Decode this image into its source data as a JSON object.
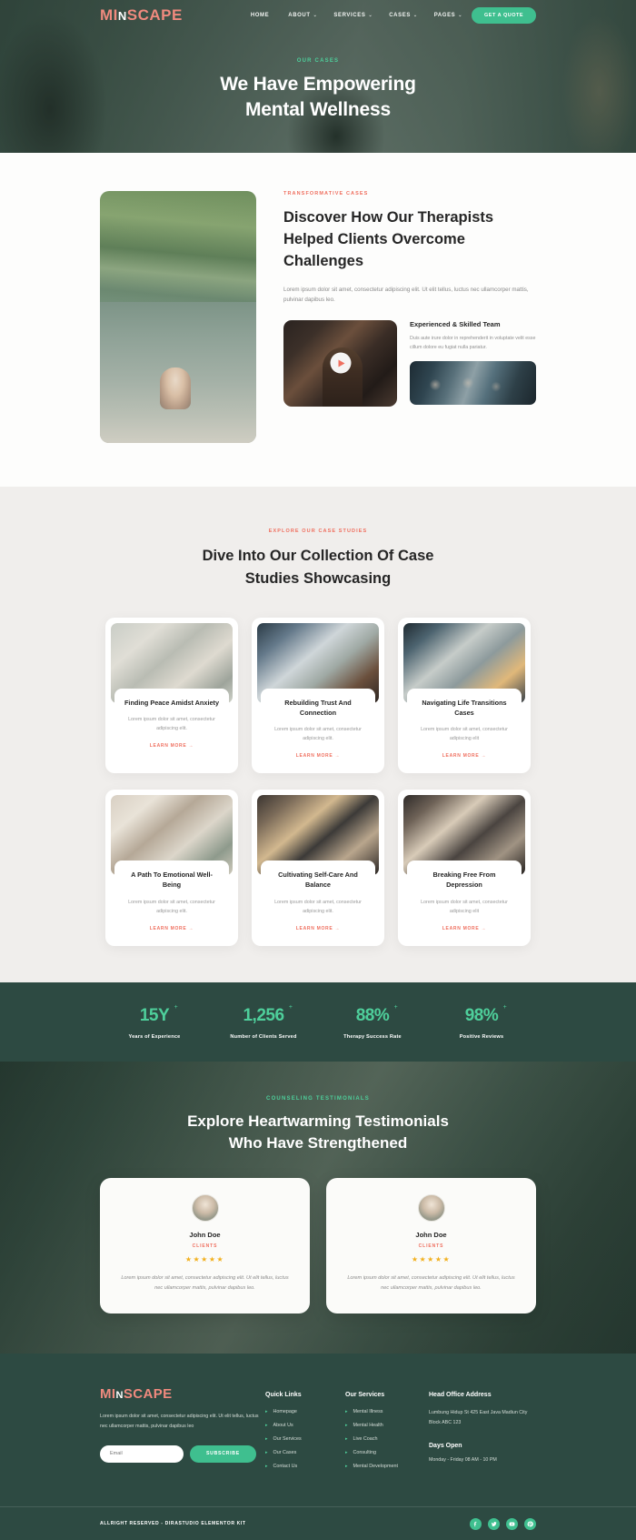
{
  "header": {
    "logo": {
      "part1": "MI",
      "part2": "N",
      "part3": "SCAPE"
    },
    "nav": [
      {
        "label": "HOME",
        "caret": ""
      },
      {
        "label": "ABOUT",
        "caret": "⌄"
      },
      {
        "label": "SERVICES",
        "caret": "⌄"
      },
      {
        "label": "CASES",
        "caret": "⌄"
      },
      {
        "label": "PAGES",
        "caret": "⌄"
      }
    ],
    "cta": "GET A QUOTE"
  },
  "hero": {
    "eyebrow": "OUR CASES",
    "title_line1": "We Have Empowering",
    "title_line2": "Mental Wellness"
  },
  "discover": {
    "eyebrow": "TRANSFORMATIVE CASES",
    "title": "Discover How Our Therapists Helped Clients Overcome Challenges",
    "description": "Lorem ipsum dolor sit amet, consectetur adipiscing elit. Ut elit tellus, luctus nec ullamcorper mattis, pulvinar dapibus leo.",
    "play_icon": "play-icon",
    "side_title": "Experienced & Skilled Team",
    "side_description": "Duis aute irure dolor in reprehenderit in voluptate velit esse cillum dolore eu fugiat nulla pariatur."
  },
  "cases": {
    "eyebrow": "EXPLORE OUR CASE STUDIES",
    "title_line1": "Dive Into Our Collection Of Case",
    "title_line2": "Studies Showcasing",
    "cards": [
      {
        "title": "Finding Peace Amidst Anxiety",
        "desc": "Lorem ipsum dolor sit amet, consectetur adipiscing elit.",
        "link": "LEARN MORE"
      },
      {
        "title": "Rebuilding Trust And Connection",
        "desc": "Lorem ipsum dolor sit amet, consectetur adipiscing elit.",
        "link": "LEARN MORE"
      },
      {
        "title": "Navigating Life Transitions Cases",
        "desc": "Lorem ipsum dolor sit amet, consectetur adipiscing elit",
        "link": "LEARN MORE"
      },
      {
        "title": "A Path To Emotional Well-Being",
        "desc": "Lorem ipsum dolor sit amet, consectetur adipiscing elit.",
        "link": "LEARN MORE"
      },
      {
        "title": "Cultivating Self-Care And Balance",
        "desc": "Lorem ipsum dolor sit amet, consectetur adipiscing elit.",
        "link": "LEARN MORE"
      },
      {
        "title": "Breaking Free From Depression",
        "desc": "Lorem ipsum dolor sit amet, consectetur adipiscing elit",
        "link": "LEARN MORE"
      }
    ]
  },
  "stats": [
    {
      "value": "15Y",
      "plus": "+",
      "label": "Years of Experience"
    },
    {
      "value": "1,256",
      "plus": "+",
      "label": "Number of Clients Served"
    },
    {
      "value": "88%",
      "plus": "+",
      "label": "Therapy Success Rate"
    },
    {
      "value": "98%",
      "plus": "+",
      "label": "Positive Reviews"
    }
  ],
  "testimonials": {
    "eyebrow": "COUNSELING TESTIMONIALS",
    "title_line1": "Explore Heartwarming Testimonials",
    "title_line2": "Who Have Strengthened",
    "cards": [
      {
        "name": "John Doe",
        "role": "CLIENTS",
        "stars": "★★★★★",
        "text": "Lorem ipsum dolor sit amet, consectetur adipiscing elit. Ut elit tellus, luctus nec ullamcorper mattis, pulvinar dapibus leo."
      },
      {
        "name": "John Doe",
        "role": "CLIENTS",
        "stars": "★★★★★",
        "text": "Lorem ipsum dolor sit amet, consectetur adipiscing elit. Ut elit tellus, luctus nec ullamcorper mattis, pulvinar dapibus leo."
      }
    ]
  },
  "footer": {
    "logo": {
      "part1": "MI",
      "part2": "N",
      "part3": "SCAPE"
    },
    "description": "Lorem ipsum dolor sit amet, consectetur adipiscing elit. Ut elit tellus, luctus nec ullamcorper mattis, pulvinar dapibus leo",
    "email_placeholder": "Email",
    "email_value": "",
    "subscribe_label": "SUBSCRIBE",
    "quick_links": {
      "title": "Quick Links",
      "items": [
        "Homepage",
        "About Us",
        "Our Services",
        "Our Cases",
        "Contact Us"
      ]
    },
    "our_services": {
      "title": "Our Services",
      "items": [
        "Mental Illness",
        "Mental Health",
        "Live Coach",
        "Consulting",
        "Mental Development"
      ]
    },
    "address": {
      "title": "Head Office Address",
      "text": "Lumbung Hidup St 425 East Java Madiun City Block ABC 123",
      "days_title": "Days Open",
      "days_text": "Monday - Friday 08 AM - 10 PM"
    },
    "copyright": "ALLRIGHT RESERVED - DIRASTUDIO ELEMENTOR KIT",
    "socials": [
      "facebook-icon",
      "twitter-icon",
      "youtube-icon",
      "pinterest-icon"
    ]
  },
  "colors": {
    "brand_salmon": "#f08a7e",
    "accent_red": "#ef6f5f",
    "accent_green": "#3fbf8f",
    "mint": "#4ecf9b",
    "dark_green": "#2d4a42",
    "star_gold": "#f2b01e"
  }
}
